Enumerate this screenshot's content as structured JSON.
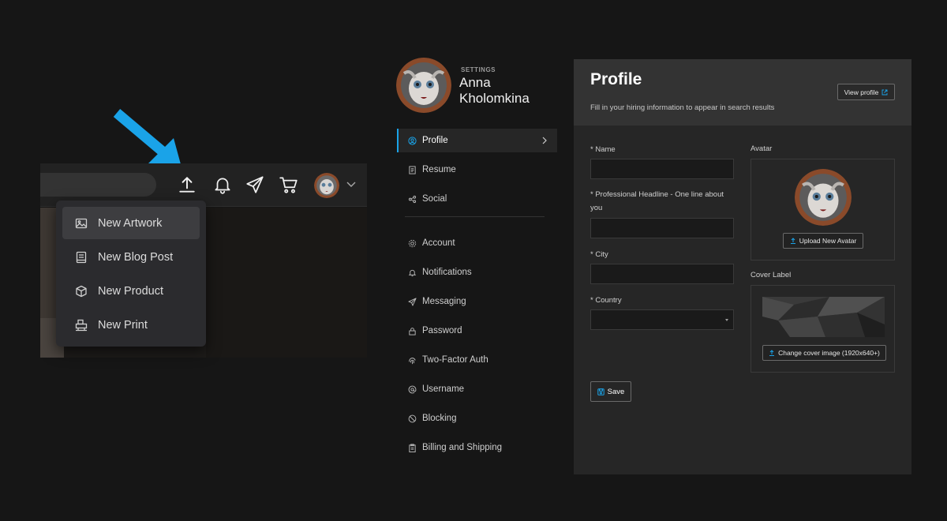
{
  "colors": {
    "accent": "#1aa3e8",
    "background": "#161616",
    "panel": "#262626"
  },
  "topbar": {
    "icons": [
      "upload-icon",
      "bell-icon",
      "send-icon",
      "cart-icon",
      "chevron-down-icon"
    ]
  },
  "create_menu": {
    "items": [
      {
        "label": "New Artwork",
        "icon": "image-icon"
      },
      {
        "label": "New Blog Post",
        "icon": "book-icon"
      },
      {
        "label": "New Product",
        "icon": "box-icon"
      },
      {
        "label": "New Print",
        "icon": "print-icon"
      }
    ]
  },
  "sidebar": {
    "section_label": "SETTINGS",
    "user_name": "Anna Kholomkina",
    "items": [
      {
        "label": "Profile",
        "icon": "user-circle-icon",
        "active": true
      },
      {
        "label": "Resume",
        "icon": "document-icon"
      },
      {
        "label": "Social",
        "icon": "share-icon"
      },
      {
        "label": "Account",
        "icon": "gear-icon"
      },
      {
        "label": "Notifications",
        "icon": "bell-icon"
      },
      {
        "label": "Messaging",
        "icon": "send-icon"
      },
      {
        "label": "Password",
        "icon": "lock-icon"
      },
      {
        "label": "Two-Factor Auth",
        "icon": "fingerprint-icon"
      },
      {
        "label": "Username",
        "icon": "at-icon"
      },
      {
        "label": "Blocking",
        "icon": "block-icon"
      },
      {
        "label": "Billing and Shipping",
        "icon": "clipboard-icon"
      }
    ]
  },
  "profile": {
    "title": "Profile",
    "subtitle": "Fill in your hiring information to appear in search results",
    "view_profile": "View profile",
    "fields": {
      "name_label": "* Name",
      "name_value": "",
      "headline_label": "* Professional Headline - One line about you",
      "headline_value": "",
      "city_label": "* City",
      "city_value": "",
      "country_label": "* Country",
      "country_value": ""
    },
    "avatar_label": "Avatar",
    "upload_avatar": "Upload New Avatar",
    "cover_label": "Cover Label",
    "change_cover": "Change cover image (1920x640+)",
    "save": "Save"
  }
}
